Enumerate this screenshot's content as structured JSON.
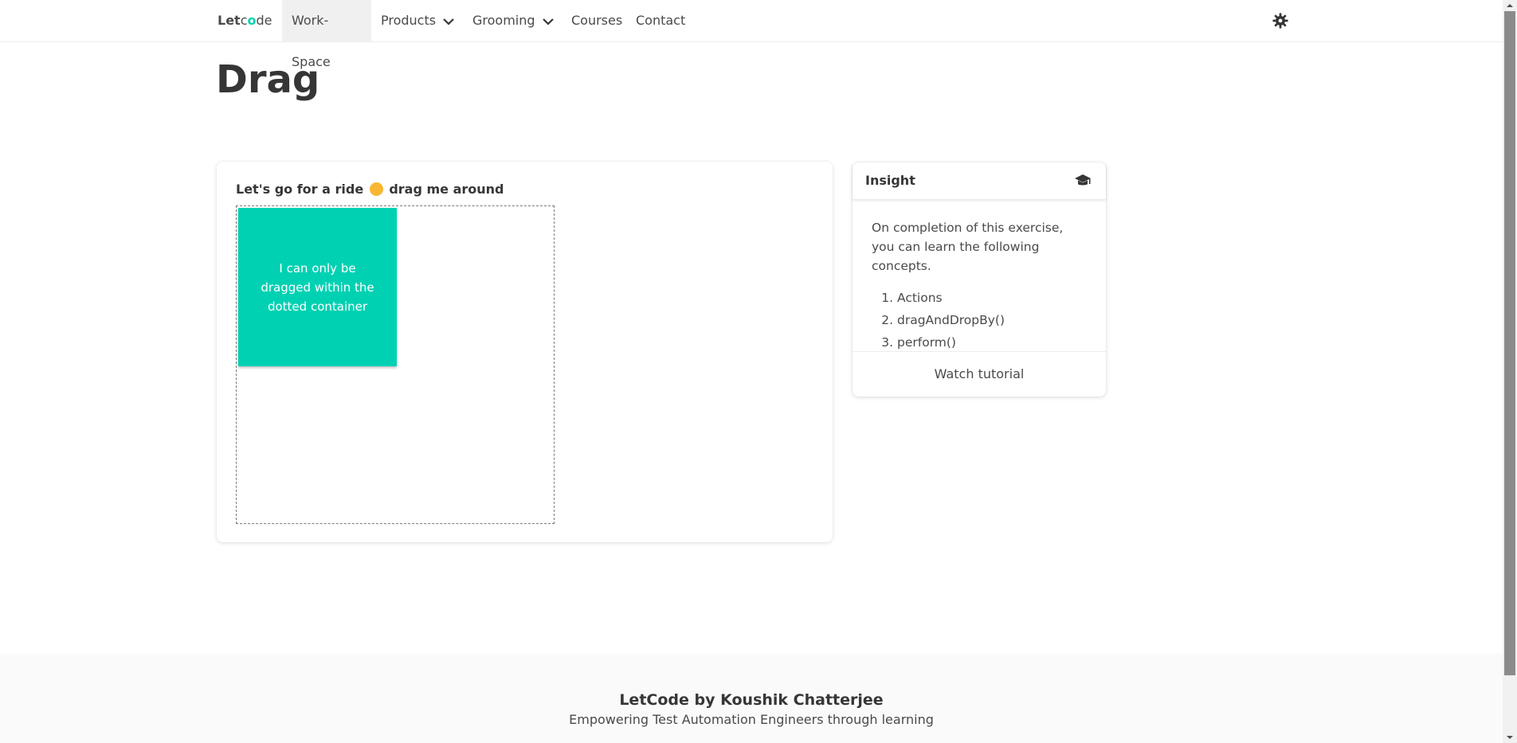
{
  "nav": {
    "brand": {
      "part1": "Let",
      "part2": "c",
      "part3": "o",
      "part4": "de"
    },
    "items": [
      {
        "label": "Work-Space",
        "active": true
      },
      {
        "label": "Products",
        "dropdown": true
      },
      {
        "label": "Grooming",
        "dropdown": true
      },
      {
        "label": "Courses"
      },
      {
        "label": "Contact"
      }
    ],
    "theme_icon": "gear-icon"
  },
  "page": {
    "title": "Drag"
  },
  "main_card": {
    "heading_before": "Let's go for a ride",
    "heading_after": "drag me around",
    "emoji_icon": "winking-face-icon",
    "draggable_text": "I can only be dragged within the dotted container"
  },
  "insight": {
    "title": "Insight",
    "icon": "graduation-cap-icon",
    "intro": "On completion of this exercise, you can learn the following concepts.",
    "concepts": [
      "Actions",
      "dragAndDropBy()",
      "perform()"
    ],
    "footer_link": "Watch tutorial"
  },
  "footer": {
    "title": "LetCode by Koushik Chatterjee",
    "subtitle": "Empowering Test Automation Engineers through learning"
  },
  "colors": {
    "accent": "#00d1b2",
    "text": "#363636",
    "footer_bg": "#fafafa"
  }
}
